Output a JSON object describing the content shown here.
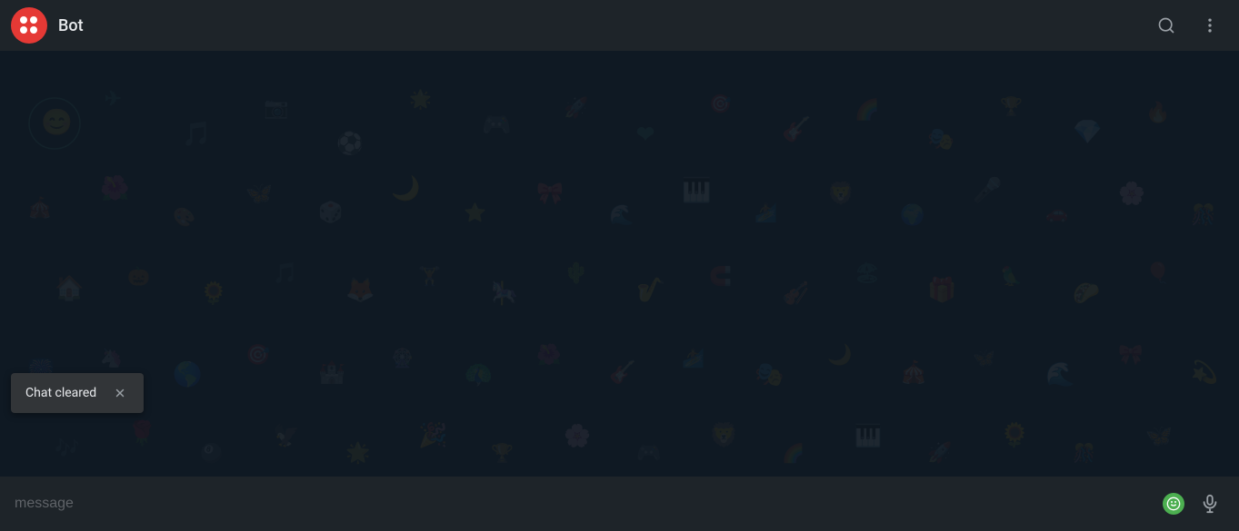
{
  "header": {
    "title": "Bot",
    "avatar_label": "Bot avatar",
    "search_label": "Search",
    "more_label": "More options"
  },
  "chat": {
    "background_label": "Chat background",
    "empty_label": "No messages"
  },
  "input": {
    "placeholder": "message",
    "emoji_label": "Emoji",
    "mic_label": "Voice message"
  },
  "snackbar": {
    "message": "Chat cleared",
    "close_label": "Close"
  },
  "icons": {
    "search": "🔍",
    "more_vert": "⋮",
    "mic": "🎤",
    "close": "✕",
    "emoji": "😊"
  }
}
